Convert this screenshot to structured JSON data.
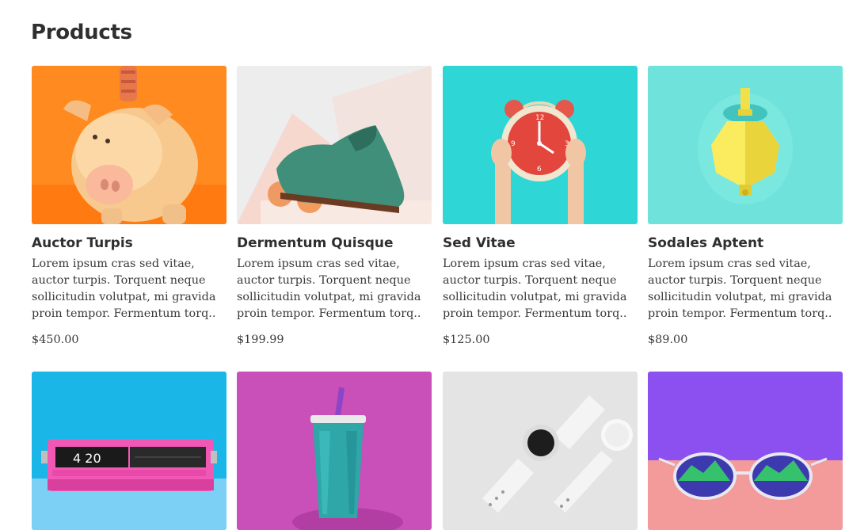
{
  "page": {
    "title": "Products"
  },
  "products": [
    {
      "name": "Auctor Turpis",
      "description": "Lorem ipsum cras sed vitae, auctor turpis. Torquent neque sollicitudin volutpat, mi gravida proin tempor. Fermentum torq..",
      "price": "$450.00",
      "image": "piggy-bank-image",
      "bg": "#ff8a1f"
    },
    {
      "name": "Dermentum Quisque",
      "description": "Lorem ipsum cras sed vitae, auctor turpis. Torquent neque sollicitudin volutpat, mi gravida proin tempor. Fermentum torq..",
      "price": "$199.99",
      "image": "shoe-image",
      "bg": "#ececec"
    },
    {
      "name": "Sed Vitae",
      "description": "Lorem ipsum cras sed vitae, auctor turpis. Torquent neque sollicitudin volutpat, mi gravida proin tempor. Fermentum torq..",
      "price": "$125.00",
      "image": "alarm-clock-image",
      "bg": "#2fd6d6"
    },
    {
      "name": "Sodales Aptent",
      "description": "Lorem ipsum cras sed vitae, auctor turpis. Torquent neque sollicitudin volutpat, mi gravida proin tempor. Fermentum torq..",
      "price": "$89.00",
      "image": "teapot-image",
      "bg": "#6fe3db"
    },
    {
      "name": "",
      "description": "",
      "price": "",
      "image": "flip-clock-image",
      "bg": "#1ab6e8"
    },
    {
      "name": "",
      "description": "",
      "price": "",
      "image": "cup-image",
      "bg": "#c94fb9"
    },
    {
      "name": "",
      "description": "",
      "price": "",
      "image": "watch-image",
      "bg": "#e4e4e4"
    },
    {
      "name": "",
      "description": "",
      "price": "",
      "image": "sunglasses-image",
      "bg": "#8b50ef"
    }
  ]
}
